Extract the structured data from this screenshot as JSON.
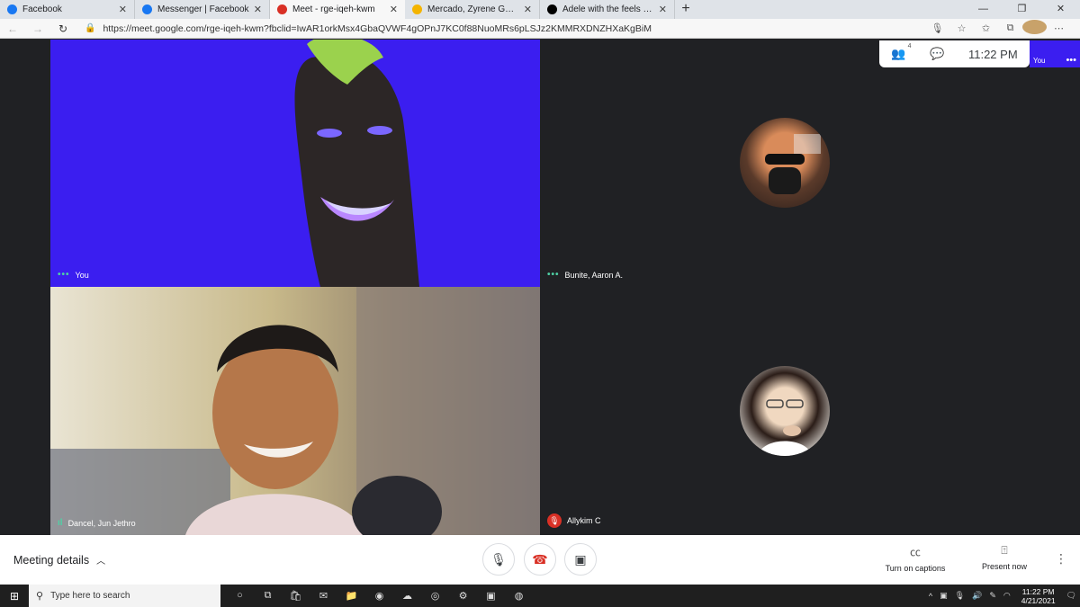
{
  "browser": {
    "tabs": [
      {
        "label": "Facebook",
        "favicon": "facebook-icon",
        "color": "#1877f2"
      },
      {
        "label": "Messenger | Facebook",
        "favicon": "facebook-icon",
        "color": "#1877f2"
      },
      {
        "label": "Meet - rge-iqeh-kwm",
        "favicon": "meet-icon",
        "color": "#d93025"
      },
      {
        "label": "Mercado, Zyrene Gwyneth A. - G",
        "favicon": "drive-icon",
        "color": "#f4b400"
      },
      {
        "label": "Adele with the feels 😄 I wanna",
        "favicon": "tiktok-icon",
        "color": "#000000"
      }
    ],
    "url": "https://meet.google.com/rge-iqeh-kwm?fbclid=IwAR1orkMsx4GbaQVWF4gOPnJ7KC0f88NuoMRs6pLSJz2KMMRXDNZHXaKgBiM"
  },
  "meet": {
    "participant_count": "4",
    "time": "11:22 PM",
    "self_label": "You",
    "tiles": [
      {
        "name": "You"
      },
      {
        "name": "Bunite, Aaron A."
      },
      {
        "name": "Dancel, Jun Jethro"
      },
      {
        "name": "Allykim C"
      }
    ],
    "bottom": {
      "details_label": "Meeting details",
      "captions_label": "Turn on captions",
      "present_label": "Present now"
    }
  },
  "taskbar": {
    "search_placeholder": "Type here to search",
    "time": "11:22 PM",
    "date": "4/21/2021"
  },
  "colors": {
    "self_tile_bg": "#3b1ef0",
    "meet_bg": "#202124",
    "speaking_green": "#4fd1a5",
    "mute_red": "#d93025"
  }
}
